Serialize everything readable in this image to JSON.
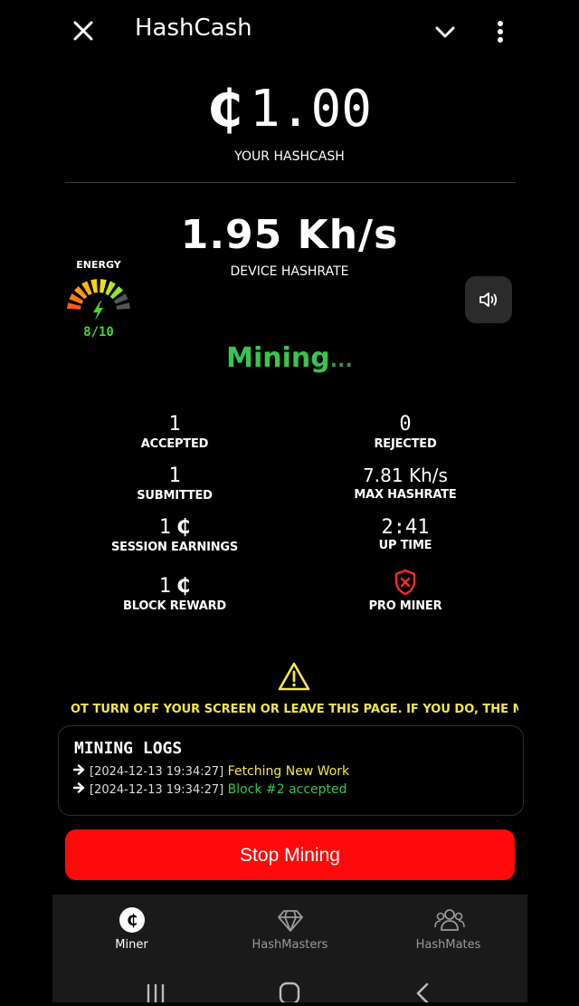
{
  "header": {
    "title": "HashCash"
  },
  "balance": {
    "currency": "₵",
    "amount": "1.00",
    "label": "YOUR HASHCASH"
  },
  "hashrate": {
    "value": "1.95 Kh/s",
    "label": "DEVICE HASHRATE"
  },
  "energy": {
    "label": "ENERGY",
    "value": "8/10",
    "level": 8,
    "max": 10
  },
  "status": {
    "text": "Mining",
    "dots": "..."
  },
  "stats": {
    "accepted": {
      "value": "1",
      "label": "ACCEPTED"
    },
    "rejected": {
      "value": "0",
      "label": "REJECTED"
    },
    "submitted": {
      "value": "1",
      "label": "SUBMITTED"
    },
    "max_hashrate": {
      "value": "7.81 Kh/s",
      "label": "MAX HASHRATE"
    },
    "session_earnings": {
      "value": "1",
      "coin": "₵",
      "label": "SESSION EARNINGS"
    },
    "up_time": {
      "value": "2:41",
      "label": "UP TIME"
    },
    "block_reward": {
      "value": "1",
      "coin": "₵",
      "label": "BLOCK REWARD"
    },
    "pro_miner": {
      "label": "PRO MINER"
    }
  },
  "warning": {
    "text": "OT TURN OFF YOUR SCREEN OR LEAVE THIS PAGE. IF YOU DO, THE MINING PI"
  },
  "logs": {
    "title": "MINING LOGS",
    "entries": [
      {
        "timestamp": "[2024-12-13 19:34:27]",
        "message": "Fetching New Work",
        "color": "#f4e64a"
      },
      {
        "timestamp": "[2024-12-13 19:34:27]",
        "message": "Block #2 accepted",
        "color": "#39c44f"
      }
    ]
  },
  "actions": {
    "stop_label": "Stop Mining"
  },
  "nav": {
    "miner": "Miner",
    "hashmasters": "HashMasters",
    "hashmates": "HashMates"
  },
  "colors": {
    "accent_red": "#ff0a0a",
    "success_green": "#39c44f",
    "warning_yellow": "#f4e64a"
  },
  "icons": [
    "close-icon",
    "chevron-down-icon",
    "more-vertical-icon",
    "speaker-icon",
    "warning-icon",
    "shield-x-icon",
    "coin-icon",
    "diamond-icon",
    "people-icon"
  ]
}
